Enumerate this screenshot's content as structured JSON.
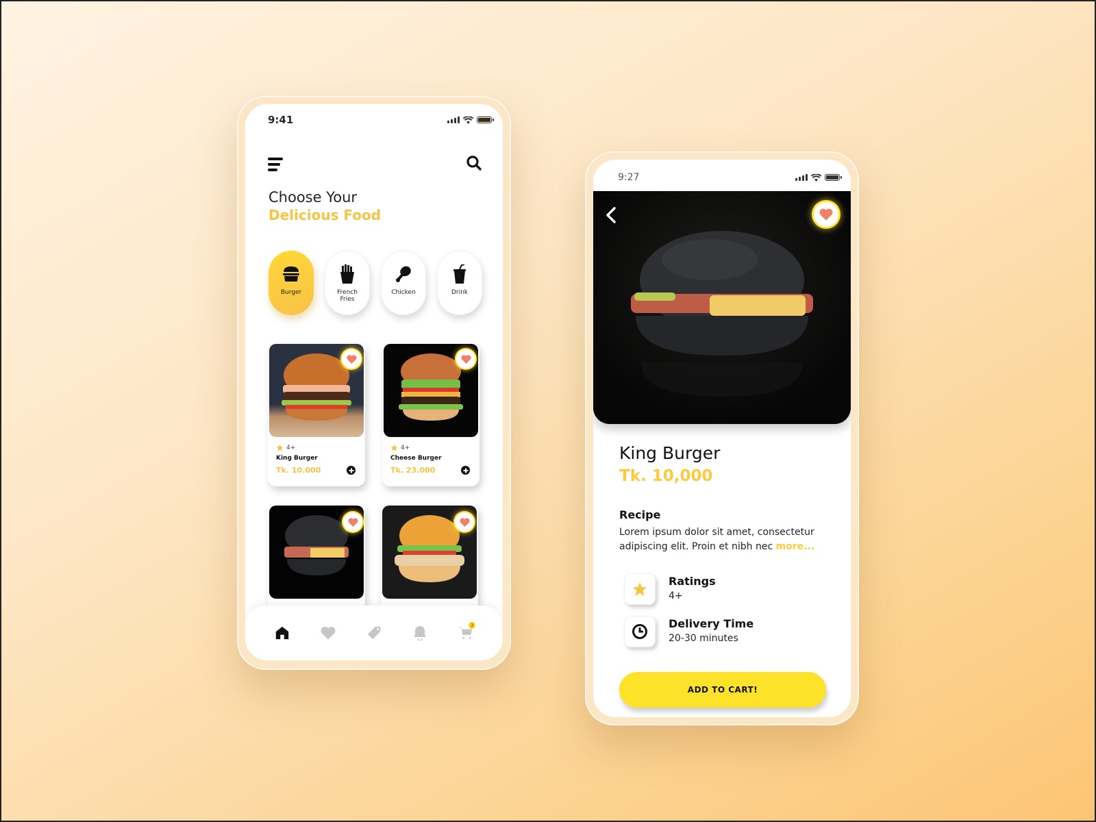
{
  "colors": {
    "accent": "#f6c445",
    "button": "#fde22a",
    "heart": "#f08068"
  },
  "home": {
    "status_time": "9:41",
    "title_line1": "Choose Your",
    "title_line2": "Delicious Food",
    "categories": [
      {
        "label": "Burger",
        "icon": "burger-icon",
        "active": true
      },
      {
        "label": "French Fries",
        "icon": "fries-icon",
        "active": false
      },
      {
        "label": "Chicken",
        "icon": "chicken-leg-icon",
        "active": false
      },
      {
        "label": "Drink",
        "icon": "drink-cup-icon",
        "active": false
      }
    ],
    "products": [
      {
        "name": "King Burger",
        "rating": "4+",
        "price": "Tk. 10.000",
        "image": "classic-burger-photo"
      },
      {
        "name": "Cheese Burger",
        "rating": "4+",
        "price": "Tk. 23.000",
        "image": "cheese-burger-photo"
      },
      {
        "name": "",
        "rating": "",
        "price": "",
        "image": "black-bun-burger-photo"
      },
      {
        "name": "",
        "rating": "",
        "price": "",
        "image": "chicken-burger-photo"
      }
    ],
    "nav": [
      {
        "name": "home",
        "icon": "home-icon",
        "active": true
      },
      {
        "name": "favorites",
        "icon": "heart-icon",
        "active": false
      },
      {
        "name": "offers",
        "icon": "tag-icon",
        "active": false
      },
      {
        "name": "notifications",
        "icon": "bell-icon",
        "active": false
      },
      {
        "name": "cart",
        "icon": "cart-icon",
        "active": false,
        "badge": "2"
      }
    ]
  },
  "detail": {
    "status_time": "9:27",
    "name": "King Burger",
    "price": "Tk. 10,000",
    "recipe_heading": "Recipe",
    "recipe_text": "Lorem ipsum dolor sit amet, consectetur adipiscing elit. Proin et nibh nec ",
    "more_link": "more...",
    "ratings_label": "Ratings",
    "ratings_value": "4+",
    "delivery_label": "Delivery Time",
    "delivery_value": "20-30 minutes",
    "add_to_cart": "ADD TO CART!"
  }
}
